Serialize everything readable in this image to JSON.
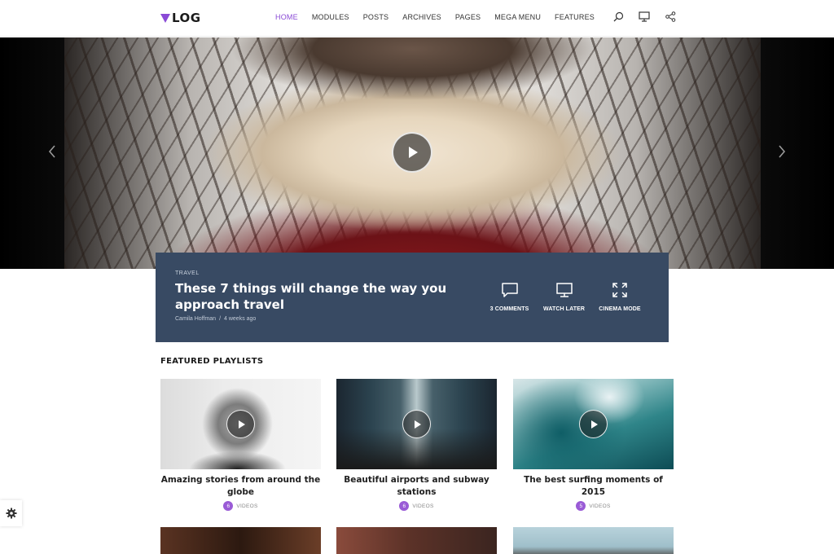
{
  "brand": {
    "name": "LOG",
    "accent": "#8a4ad6"
  },
  "nav": {
    "items": [
      {
        "label": "HOME",
        "active": true
      },
      {
        "label": "MODULES"
      },
      {
        "label": "POSTS"
      },
      {
        "label": "ARCHIVES"
      },
      {
        "label": "PAGES"
      },
      {
        "label": "MEGA MENU"
      },
      {
        "label": "FEATURES"
      }
    ]
  },
  "header_icons": [
    "search-icon",
    "monitor-icon",
    "share-icon"
  ],
  "hero": {
    "category": "TRAVEL",
    "title": "These 7 things will change the way you approach travel",
    "author": "Camila Hoffman",
    "separator": "/",
    "date": "4 weeks ago",
    "actions": [
      {
        "label": "3 COMMENTS",
        "icon": "comment-icon"
      },
      {
        "label": "WATCH LATER",
        "icon": "monitor-icon"
      },
      {
        "label": "CINEMA MODE",
        "icon": "expand-icon"
      }
    ],
    "infobar_color": "#384a63"
  },
  "playlists": {
    "heading": "FEATURED PLAYLISTS",
    "items": [
      {
        "title": "Amazing stories from around the globe",
        "count": "6",
        "unit": "VIDEOS"
      },
      {
        "title": "Beautiful airports and subway stations",
        "count": "6",
        "unit": "VIDEOS"
      },
      {
        "title": "The best surfing moments of 2015",
        "count": "5",
        "unit": "VIDEOS"
      }
    ]
  }
}
